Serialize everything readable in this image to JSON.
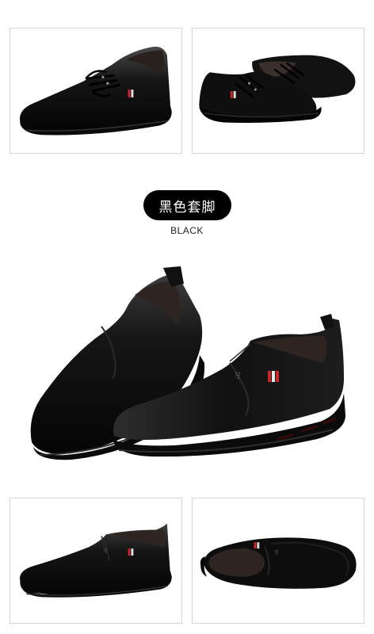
{
  "gallery": {
    "top_left": {
      "icon": "lace-up-shoe-side-view"
    },
    "top_right": {
      "icon": "lace-up-shoe-pair-view"
    },
    "bottom_left": {
      "icon": "slip-on-shoe-side-view"
    },
    "bottom_right": {
      "icon": "slip-on-shoe-top-view"
    }
  },
  "variant": {
    "label_cn": "黑色套脚",
    "label_en": "BLACK"
  },
  "hero": {
    "icon": "slip-on-shoe-pair"
  },
  "colors": {
    "leather": "#111111",
    "sole": "#1c1c1c",
    "lining": "#3a2f2c",
    "accent_red": "#c8262b",
    "pill_bg": "#000000",
    "border": "#d6d6d6"
  }
}
